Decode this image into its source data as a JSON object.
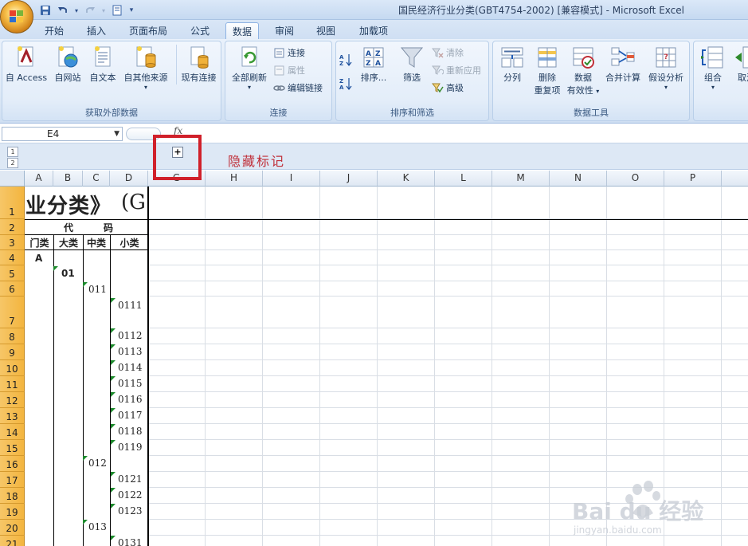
{
  "window": {
    "title": "国民经济行业分类(GBT4754-2002)  [兼容模式] - Microsoft Excel"
  },
  "quick_access": {
    "icons": [
      "save-icon",
      "undo-icon",
      "redo-icon",
      "print-preview-icon",
      "customize-icon"
    ]
  },
  "tabs": [
    {
      "label": "开始",
      "active": false
    },
    {
      "label": "插入",
      "active": false
    },
    {
      "label": "页面布局",
      "active": false
    },
    {
      "label": "公式",
      "active": false
    },
    {
      "label": "数据",
      "active": true
    },
    {
      "label": "审阅",
      "active": false
    },
    {
      "label": "视图",
      "active": false
    },
    {
      "label": "加载项",
      "active": false
    }
  ],
  "ribbon": {
    "external": {
      "label": "获取外部数据",
      "access": "自 Access",
      "web": "自网站",
      "text": "自文本",
      "other": "自其他来源",
      "existing": "现有连接"
    },
    "connections": {
      "label": "连接",
      "refresh_all": "全部刷新",
      "connections": "连接",
      "properties": "属性",
      "edit_links": "编辑链接"
    },
    "sort_filter": {
      "label": "排序和筛选",
      "sort": "排序...",
      "filter": "筛选",
      "clear": "清除",
      "reapply": "重新应用",
      "advanced": "高级"
    },
    "data_tools": {
      "label": "数据工具",
      "text_to_columns": "分列",
      "remove_dup_1": "删除",
      "remove_dup_2": "重复项",
      "validation_1": "数据",
      "validation_2": "有效性",
      "consolidate": "合并计算",
      "what_if": "假设分析"
    },
    "outline": {
      "group": "组合",
      "ungroup": "取消"
    }
  },
  "formula_bar": {
    "name_box": "E4",
    "fx": "fx"
  },
  "outline_bar": {
    "levels": [
      "1",
      "2"
    ],
    "expand": "+"
  },
  "annotation": {
    "text": "隐藏标记"
  },
  "columns": [
    "A",
    "B",
    "C",
    "D",
    "G",
    "H",
    "I",
    "J",
    "K",
    "L",
    "M",
    "N",
    "O",
    "P"
  ],
  "rows": [
    "1",
    "2",
    "3",
    "4",
    "5",
    "6",
    "7",
    "8",
    "9",
    "10",
    "11",
    "12",
    "13",
    "14",
    "15",
    "16",
    "17",
    "18",
    "19",
    "20",
    "21"
  ],
  "sheet": {
    "title_fragment": "业分类》",
    "title_right": "(G",
    "code_label_1": "代",
    "code_label_2": "码",
    "hdr_a": "门类",
    "hdr_b": "大类",
    "hdr_c": "中类",
    "hdr_d": "小类",
    "a4": "A",
    "b5": "01",
    "c6": "011",
    "d7": "0111",
    "d8": "0112",
    "d9": "0113",
    "d10": "0114",
    "d11": "0115",
    "d12": "0116",
    "d13": "0117",
    "d14": "0118",
    "d15": "0119",
    "c16": "012",
    "d17": "0121",
    "d18": "0122",
    "d19": "0123",
    "c20": "013",
    "d21": "0131"
  },
  "watermark": {
    "brand": "Bai du 经验",
    "url": "jingyan.baidu.com"
  },
  "colors": {
    "annotation_red": "#d0202a",
    "row_header_orange": "#f3b53f",
    "comment_marker_green": "#1c8a2c"
  }
}
